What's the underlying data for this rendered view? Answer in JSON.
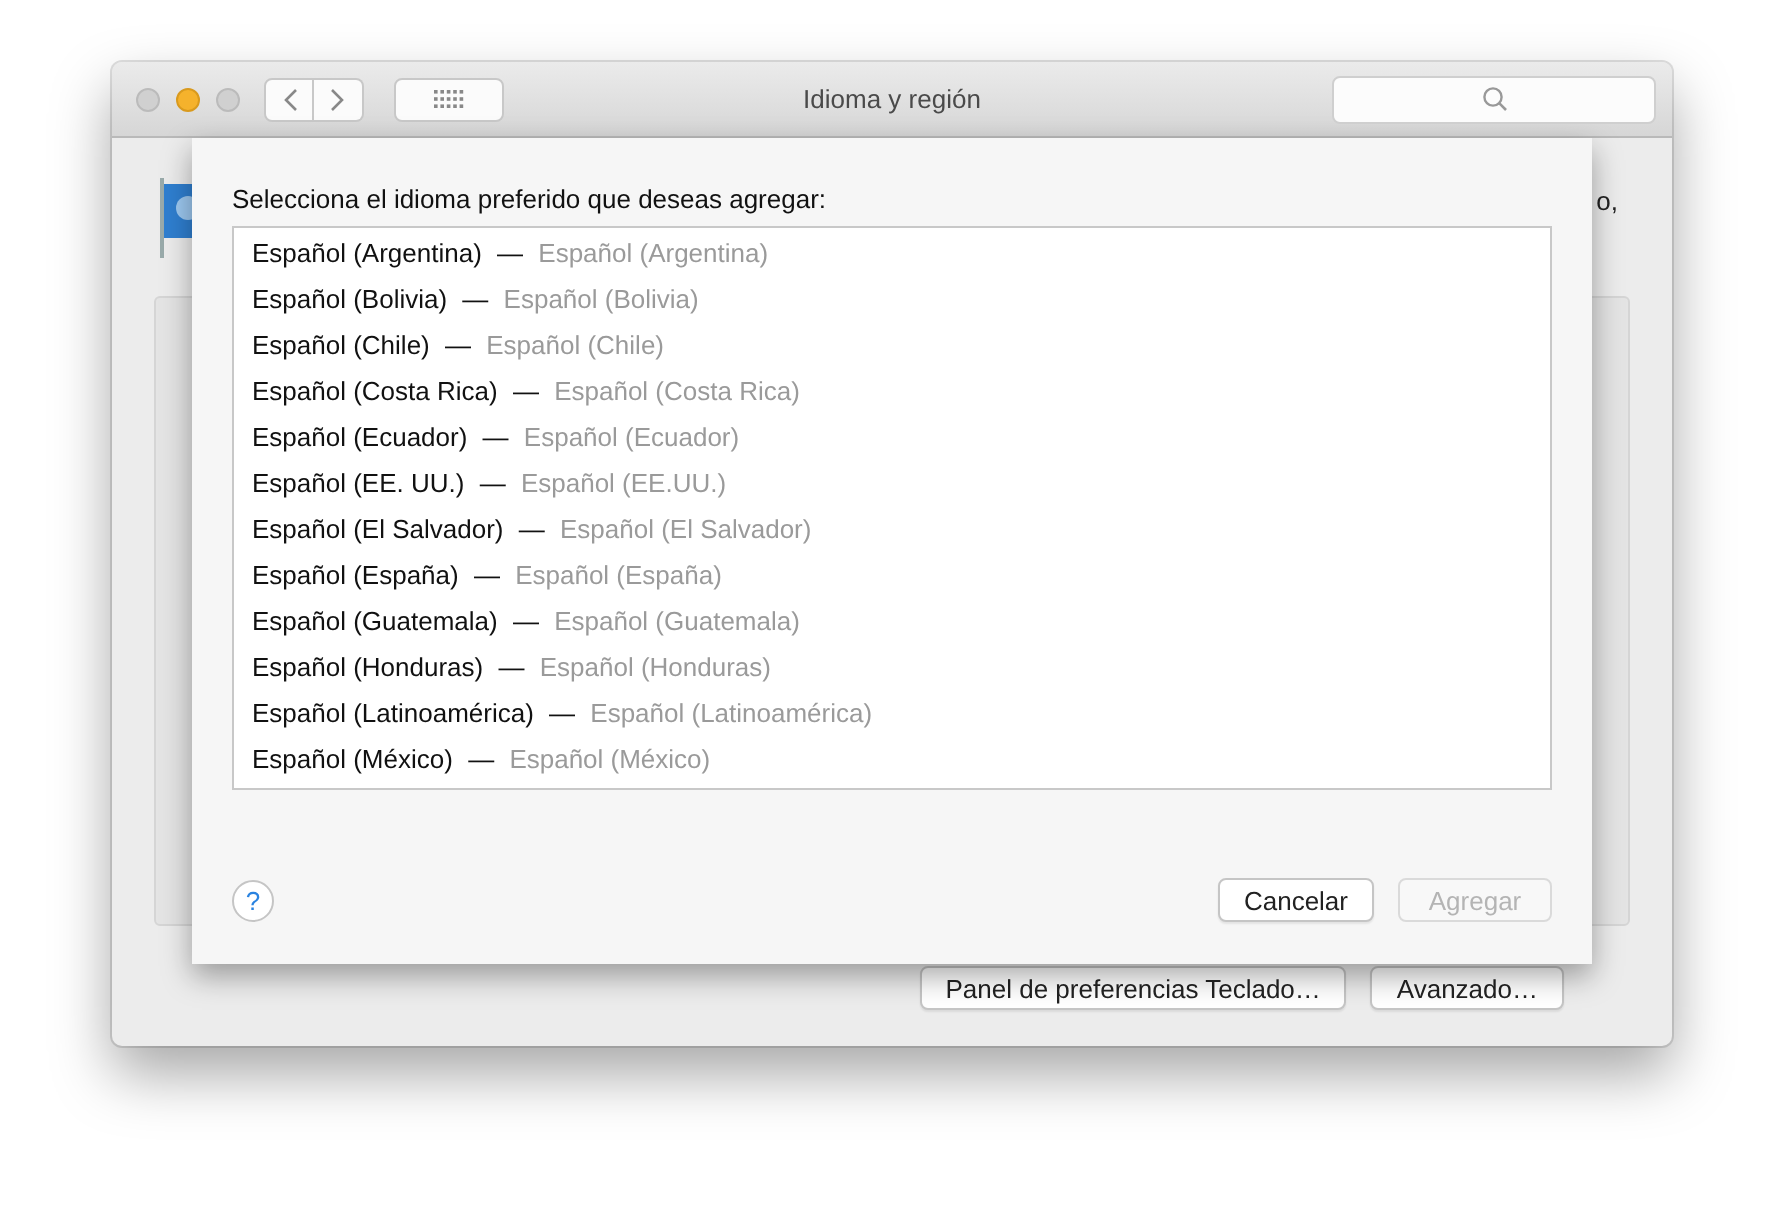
{
  "window": {
    "title": "Idioma y región"
  },
  "background_text": "o,",
  "sheet": {
    "prompt": "Selecciona el idioma preferido que deseas agregar:",
    "languages": [
      {
        "name": "Español (Argentina)",
        "dash": "—",
        "native": "Español (Argentina)"
      },
      {
        "name": "Español (Bolivia)",
        "dash": "—",
        "native": "Español (Bolivia)"
      },
      {
        "name": "Español (Chile)",
        "dash": "—",
        "native": "Español (Chile)"
      },
      {
        "name": "Español (Costa Rica)",
        "dash": "—",
        "native": "Español (Costa Rica)"
      },
      {
        "name": "Español (Ecuador)",
        "dash": "—",
        "native": "Español (Ecuador)"
      },
      {
        "name": "Español (EE. UU.)",
        "dash": "—",
        "native": "Español (EE.UU.)"
      },
      {
        "name": "Español (El Salvador)",
        "dash": "—",
        "native": "Español (El Salvador)"
      },
      {
        "name": "Español (España)",
        "dash": "—",
        "native": "Español (España)"
      },
      {
        "name": "Español (Guatemala)",
        "dash": "—",
        "native": "Español (Guatemala)"
      },
      {
        "name": "Español (Honduras)",
        "dash": "—",
        "native": "Español (Honduras)"
      },
      {
        "name": "Español (Latinoamérica)",
        "dash": "—",
        "native": "Español (Latinoamérica)"
      },
      {
        "name": "Español (México)",
        "dash": "—",
        "native": "Español (México)"
      }
    ],
    "help": "?",
    "buttons": [
      {
        "label": "Cancelar",
        "disabled": false
      },
      {
        "label": "Agregar",
        "disabled": true
      }
    ]
  },
  "bottom_buttons": [
    "Panel de preferencias Teclado…",
    "Avanzado…"
  ]
}
